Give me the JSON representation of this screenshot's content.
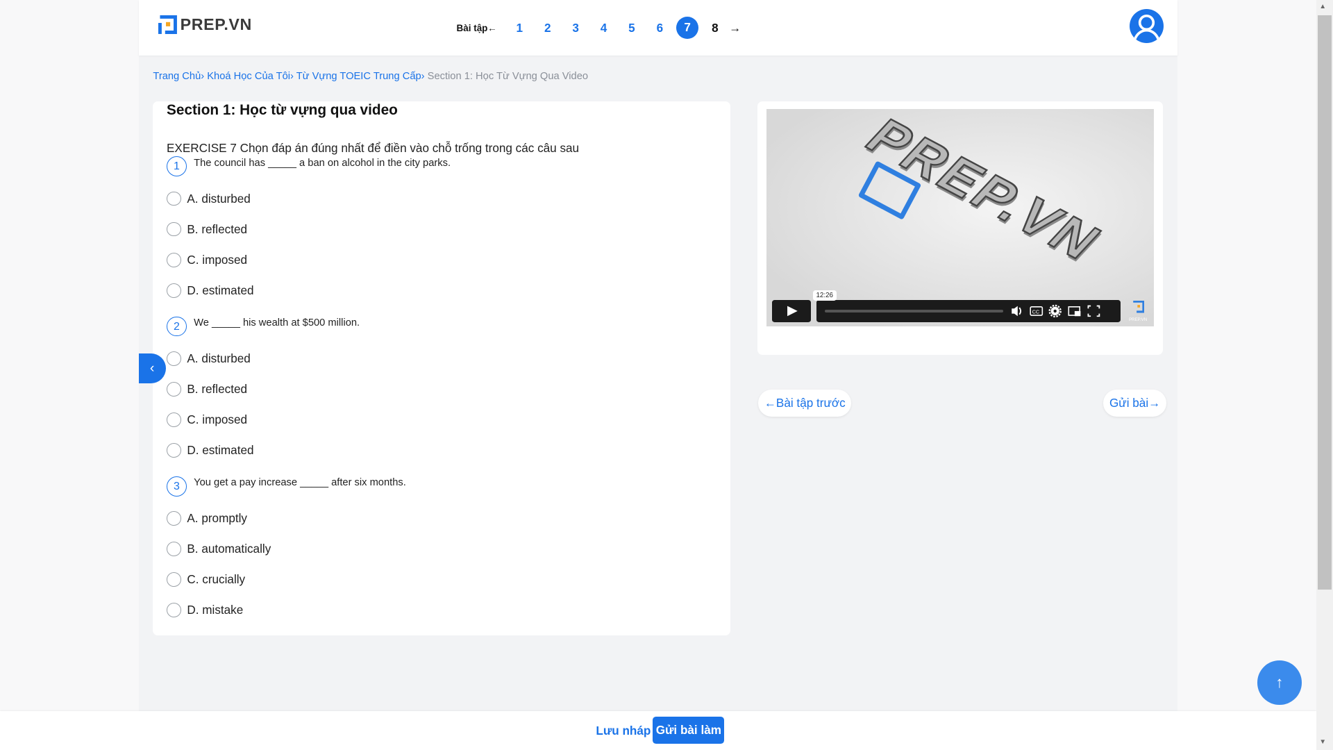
{
  "header": {
    "logo_text": "PREP.VN",
    "nav_label": "Bài tập",
    "pages": [
      "1",
      "2",
      "3",
      "4",
      "5",
      "6",
      "7",
      "8"
    ],
    "active_page": "7",
    "prev_arrow": "←",
    "next_arrow": "→"
  },
  "breadcrumb": [
    "Trang Chủ",
    "Khoá Học Của Tôi",
    "Từ Vựng TOEIC Trung Cấp",
    "Section 1: Học Từ Vựng Qua Video"
  ],
  "main": {
    "title": "Section 1: Học từ vựng qua video",
    "exercise": "EXERCISE 7 Chọn đáp án đúng nhất để điền vào chỗ trống trong các câu sau",
    "questions": [
      {
        "num": "1",
        "text": "The council has _____ a ban on alcohol in the city parks.",
        "options": [
          "A. disturbed",
          "B. reflected",
          "C. imposed",
          "D. estimated"
        ]
      },
      {
        "num": "2",
        "text": "We _____ his wealth at $500 million.",
        "options": [
          "A. disturbed",
          "B. reflected",
          "C. imposed",
          "D. estimated"
        ]
      },
      {
        "num": "3",
        "text": "You get a pay increase _____ after six months.",
        "options": [
          "A. promptly",
          "B. automatically",
          "C. crucially",
          "D. mistake"
        ]
      }
    ]
  },
  "video": {
    "watermark": "PREP.VN",
    "duration_tooltip": "12:26",
    "corner_logo": "PREP.VN",
    "progress": 0
  },
  "side_nav": {
    "prev_label": "←Bài tập trước",
    "next_label": "Gửi bài→"
  },
  "footer": {
    "save_label": "Lưu nháp",
    "submit_label": "Gửi bài làm"
  },
  "colors": {
    "accent": "#1a73e8",
    "background": "#f2f3f5"
  }
}
